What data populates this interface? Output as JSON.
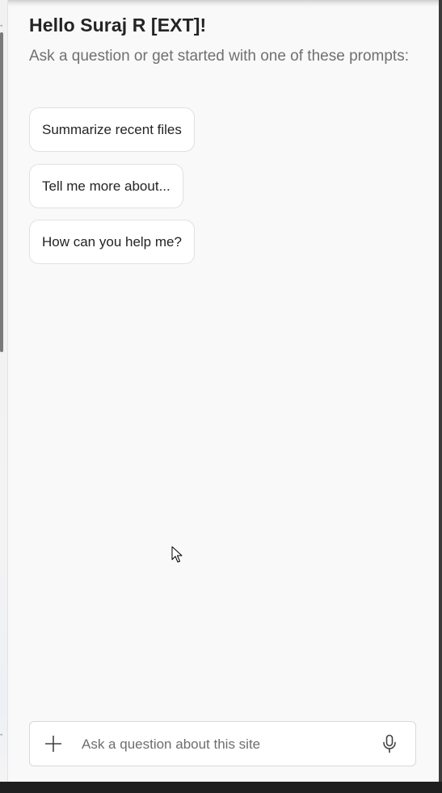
{
  "greeting": "Hello Suraj R [EXT]!",
  "subtitle": "Ask a question or get started with one of these prompts:",
  "prompts": [
    {
      "label": "Summarize recent files"
    },
    {
      "label": "Tell me more about..."
    },
    {
      "label": "How can you help me?"
    }
  ],
  "composer": {
    "placeholder": "Ask a question about this site",
    "value": "",
    "add_icon": "plus-icon",
    "mic_icon": "microphone-icon"
  },
  "colors": {
    "panel_background": "#f9f9f9",
    "text_primary": "#242424",
    "text_secondary": "#707070",
    "card_border": "#e1e1e1"
  }
}
